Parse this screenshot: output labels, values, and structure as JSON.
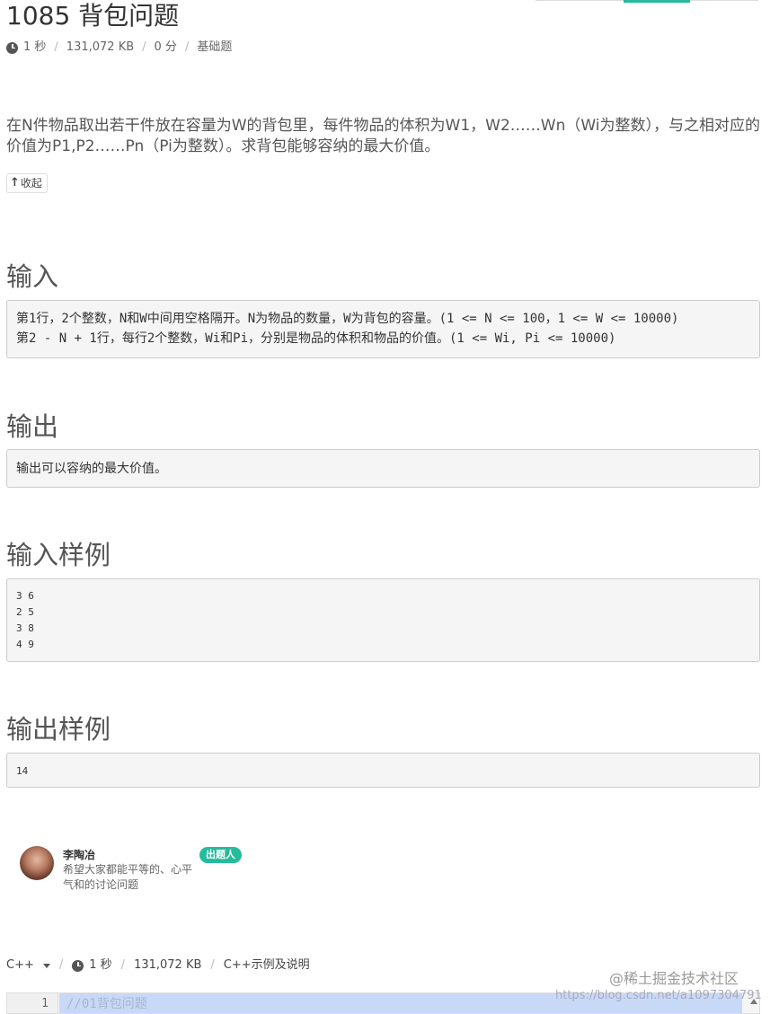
{
  "problem": {
    "title": "1085 背包问题",
    "time_limit": "1 秒",
    "memory_limit": "131,072 KB",
    "score": "0 分",
    "difficulty": "基础题",
    "description": "在N件物品取出若干件放在容量为W的背包里，每件物品的体积为W1，W2……Wn（Wi为整数），与之相对应的价值为P1,P2……Pn（Pi为整数）。求背包能够容纳的最大价值。",
    "collapse_label": "收起"
  },
  "sections": {
    "input_title": "输入",
    "input_lines": [
      "第1行，2个整数，N和W中间用空格隔开。N为物品的数量，W为背包的容量。(1 <= N <= 100，1 <= W <= 10000)",
      "第2 - N + 1行，每行2个整数，Wi和Pi，分别是物品的体积和物品的价值。(1 <= Wi, Pi <= 10000)"
    ],
    "output_title": "输出",
    "output_text": "输出可以容纳的最大价值。",
    "sample_input_title": "输入样例",
    "sample_input_lines": [
      "3 6",
      "2 5",
      "3 8",
      "4 9"
    ],
    "sample_output_title": "输出样例",
    "sample_output_text": "14"
  },
  "author": {
    "name": "李陶冶",
    "bio": "希望大家都能平等的、心平气和的讨论问题",
    "badge": "出题人"
  },
  "editor": {
    "language": "C++",
    "time_limit": "1 秒",
    "memory_limit": "131,072 KB",
    "example_link": "C++示例及说明",
    "line_number": "1",
    "line_text": "//01背包问题"
  },
  "watermarks": {
    "site": "@稀土掘金技术社区",
    "url": "https://blog.csdn.net/a1097304791"
  },
  "colors": {
    "accent": "#25bb9b",
    "editor_highlight": "#c8d9f8"
  }
}
